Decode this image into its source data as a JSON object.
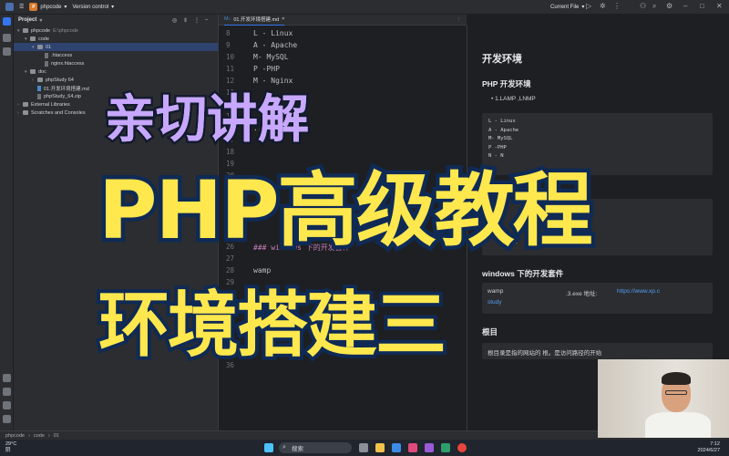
{
  "titlebar": {
    "project_badge": "P",
    "project_name": "phpcode",
    "vcs": "Version control",
    "run_config": "Current File"
  },
  "project_panel": {
    "title": "Project",
    "tree": [
      {
        "label": "phpcode",
        "hint": "E:\\phpcode"
      },
      {
        "label": "code"
      },
      {
        "label": "01"
      },
      {
        "label": ".htaccess"
      },
      {
        "label": "nginx.htaccess"
      },
      {
        "label": "doc"
      },
      {
        "label": "phpStudy 64"
      },
      {
        "label": "01.开发环境搭建.md"
      },
      {
        "label": "phpStudy_64.zip"
      },
      {
        "label": "External Libraries"
      },
      {
        "label": "Scratches and Consoles"
      }
    ]
  },
  "editor": {
    "tab_label": "01.开发环境搭建.md",
    "line_numbers": [
      "8",
      "9",
      "10",
      "11",
      "12",
      "13",
      "14",
      "15",
      "16",
      "17",
      "18",
      "19",
      "20",
      "21",
      "22",
      "23",
      "24",
      "25",
      "26",
      "27",
      "28",
      "29",
      "30",
      "31",
      "32",
      "33",
      "34",
      "35",
      "36"
    ],
    "lines": {
      "l8": "L - Linux",
      "l9": "A - Apache",
      "l10": "M- MySQL",
      "l11": "P -PHP",
      "l12": "M - Nginx",
      "l16": "...",
      "l26": "### windows 下的开发套件",
      "l29": "wamp"
    }
  },
  "preview": {
    "h1": "开发环境",
    "h2_php": "PHP 开发环境",
    "bullet": "1.LAMP ,LNMP",
    "code_lines": [
      "L - Linux",
      "A - Apache",
      "M- MySQL",
      "P -PHP",
      "N - N"
    ],
    "code2_tail": "Nginx",
    "h2_windows": "windows 下的开发套件",
    "wamp_prefix": "wamp",
    "wamp_middle": ".3.exe 地址:",
    "wamp_link": "https://www.xp.c",
    "wamp_link2": "study",
    "h2_root": "根目",
    "root_text": "根目录是指的网站的 根。是访问路径的开始"
  },
  "breadcrumb": [
    "phpcode",
    "code",
    "01"
  ],
  "taskbar": {
    "search_placeholder": "搜索",
    "weather_temp": "29°C",
    "weather_desc": "阴",
    "clock_time": "7:12",
    "clock_date": "2024/6/27"
  },
  "overlay": {
    "line1": "亲切讲解",
    "line2": "PHP高级教程",
    "line3": "环境搭建三"
  }
}
